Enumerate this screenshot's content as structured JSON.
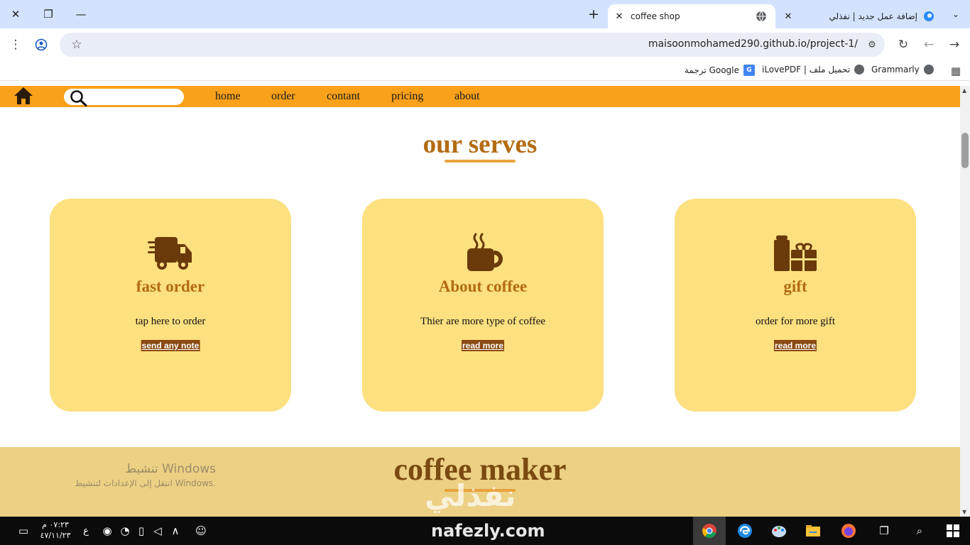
{
  "browser": {
    "tabs": [
      {
        "title": "coffee shop",
        "active": true
      },
      {
        "title": "إضافة عمل جديد | نفذلي",
        "active": false
      }
    ],
    "url": "maisoonmohamed290.github.io/project-1/",
    "bookmarks": [
      {
        "label": "Grammarly",
        "icon": "globe-icon"
      },
      {
        "label": "iLovePDF | تحميل ملف",
        "icon": "globe-icon"
      },
      {
        "label": "ترجمة Google",
        "icon": "google-translate-icon"
      }
    ]
  },
  "site": {
    "nav": {
      "search_placeholder": "",
      "links": [
        "home",
        "order",
        "contant",
        "pricing",
        "about"
      ]
    },
    "serves": {
      "title": "our serves",
      "cards": [
        {
          "icon": "truck-fast-icon",
          "title": "fast order",
          "desc": "tap here to order",
          "button": "send any note"
        },
        {
          "icon": "coffee-mug-icon",
          "title": "About coffee",
          "desc": "Thier are more type of coffee",
          "button": "read more"
        },
        {
          "icon": "gift-icon",
          "title": "gift",
          "desc": "order for more gift",
          "button": "read more"
        }
      ]
    },
    "maker": {
      "title": "coffee maker"
    }
  },
  "overlay": {
    "windows_activate_title": "تنشيط Windows",
    "windows_activate_sub": "انتقل إلى الإعدادات لتنشيط Windows.",
    "nafezly_ar": "نفذلي",
    "nafezly_en": "nafezly.com"
  },
  "taskbar": {
    "time": "٠٧:٢٣ م",
    "date": "٤٧/١١/٢٣",
    "lang": "ع"
  },
  "colors": {
    "nav_orange": "#f9a11b",
    "card_yellow": "#fde080",
    "title_brown": "#b36b12",
    "button_brown": "#8a4a12",
    "maker_band": "#ecd084"
  }
}
